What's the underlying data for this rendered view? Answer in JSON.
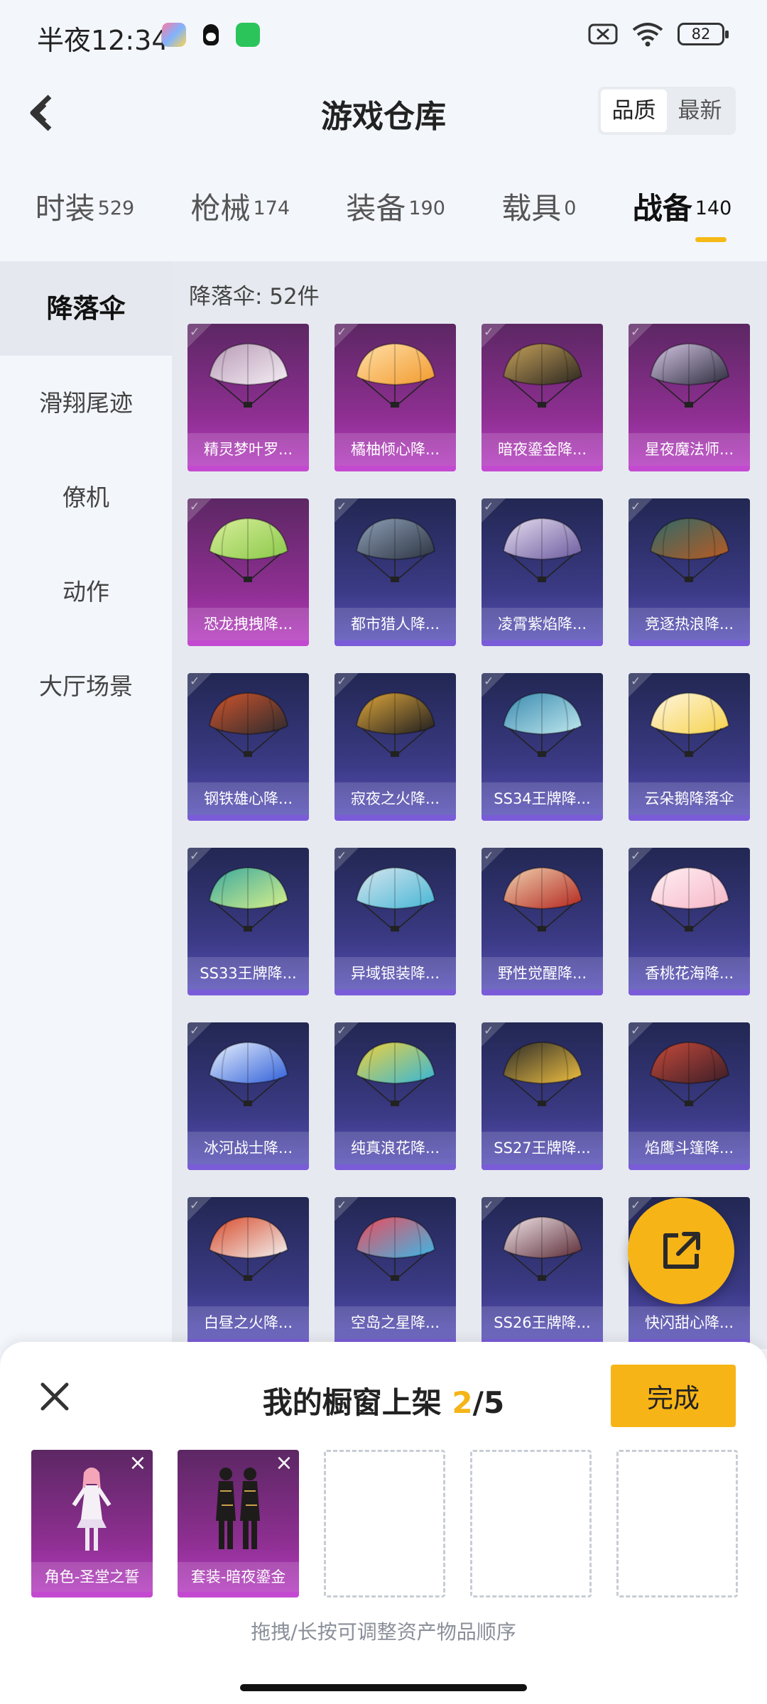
{
  "status_bar": {
    "time": "半夜12:34",
    "battery": "82"
  },
  "header": {
    "title": "游戏仓库",
    "sort_options": [
      "品质",
      "最新"
    ]
  },
  "category_tabs": [
    {
      "name": "时装",
      "count": "529"
    },
    {
      "name": "枪械",
      "count": "174"
    },
    {
      "name": "装备",
      "count": "190"
    },
    {
      "name": "载具",
      "count": "0"
    },
    {
      "name": "战备",
      "count": "140"
    }
  ],
  "side_menu": [
    "降落伞",
    "滑翔尾迹",
    "僚机",
    "动作",
    "大厅场景"
  ],
  "content": {
    "count_label": "降落伞: 52件",
    "items": [
      {
        "label": "精灵梦叶罗...",
        "rarity": "purple",
        "colors": [
          "#f4eef4",
          "#b89ab6"
        ]
      },
      {
        "label": "橘柚倾心降...",
        "rarity": "purple",
        "colors": [
          "#f29a2e",
          "#ffe0a8"
        ]
      },
      {
        "label": "暗夜鎏金降...",
        "rarity": "purple",
        "colors": [
          "#2a2620",
          "#c7a25a"
        ]
      },
      {
        "label": "星夜魔法师...",
        "rarity": "purple",
        "colors": [
          "#2c2b3c",
          "#d6c7e6"
        ]
      },
      {
        "label": "恐龙拽拽降...",
        "rarity": "purple",
        "colors": [
          "#8bc94a",
          "#d8ee9a"
        ]
      },
      {
        "label": "都市猎人降...",
        "rarity": "blue",
        "colors": [
          "#2b3340",
          "#8fa0b8"
        ]
      },
      {
        "label": "凌霄紫焰降...",
        "rarity": "blue",
        "colors": [
          "#6a5a9e",
          "#e6def0"
        ]
      },
      {
        "label": "竞逐热浪降...",
        "rarity": "blue",
        "colors": [
          "#b85a22",
          "#2e6a6a"
        ]
      },
      {
        "label": "钢铁雄心降...",
        "rarity": "blue",
        "colors": [
          "#2a2a2e",
          "#d2552c"
        ]
      },
      {
        "label": "寂夜之火降...",
        "rarity": "blue",
        "colors": [
          "#1c1c20",
          "#e0a83a"
        ]
      },
      {
        "label": "SS34王牌降...",
        "rarity": "blue",
        "colors": [
          "#bfe8ee",
          "#3a8ab0"
        ]
      },
      {
        "label": "云朵鹅降落伞",
        "rarity": "blue",
        "colors": [
          "#f6d24c",
          "#fff6e0"
        ]
      },
      {
        "label": "SS33王牌降...",
        "rarity": "blue",
        "colors": [
          "#d8f08a",
          "#3aa8a0"
        ]
      },
      {
        "label": "异域银装降...",
        "rarity": "blue",
        "colors": [
          "#46b6d6",
          "#d8e6ee"
        ]
      },
      {
        "label": "野性觉醒降...",
        "rarity": "blue",
        "colors": [
          "#b3261e",
          "#f0d2b0"
        ]
      },
      {
        "label": "香桃花海降...",
        "rarity": "blue",
        "colors": [
          "#f6b7c8",
          "#fff0f4"
        ]
      },
      {
        "label": "冰河战士降...",
        "rarity": "blue",
        "colors": [
          "#2f5fd8",
          "#eaf2ff"
        ]
      },
      {
        "label": "纯真浪花降...",
        "rarity": "blue",
        "colors": [
          "#35b6d8",
          "#f2d23a"
        ]
      },
      {
        "label": "SS27王牌降...",
        "rarity": "blue",
        "colors": [
          "#f0c040",
          "#2a2a2a"
        ]
      },
      {
        "label": "焰鹰斗篷降...",
        "rarity": "blue",
        "colors": [
          "#3a1e28",
          "#c84a3a"
        ]
      },
      {
        "label": "白昼之火降...",
        "rarity": "blue",
        "colors": [
          "#f2f2f2",
          "#d84a2a"
        ]
      },
      {
        "label": "空岛之星降...",
        "rarity": "blue",
        "colors": [
          "#3ab8e8",
          "#f04a5a"
        ]
      },
      {
        "label": "SS26王牌降...",
        "rarity": "blue",
        "colors": [
          "#5a2a36",
          "#f2e6ea"
        ]
      },
      {
        "label": "快闪甜心降...",
        "rarity": "blue",
        "colors": [
          "#f6b416",
          "#f6b416"
        ]
      }
    ]
  },
  "showcase": {
    "title_prefix": "我的橱窗上架 ",
    "count_current": "2",
    "count_total": "/5",
    "done_label": "完成",
    "slots": [
      {
        "label": "角色-圣堂之誓",
        "filled": true
      },
      {
        "label": "套装-暗夜鎏金",
        "filled": true
      },
      {
        "label": "",
        "filled": false
      },
      {
        "label": "",
        "filled": false
      },
      {
        "label": "",
        "filled": false
      }
    ],
    "hint": "拖拽/长按可调整资产物品顺序"
  },
  "colors": {
    "accent": "#f6b416",
    "purple_rarity": "#8e2f92",
    "blue_rarity": "#3b3a85"
  }
}
